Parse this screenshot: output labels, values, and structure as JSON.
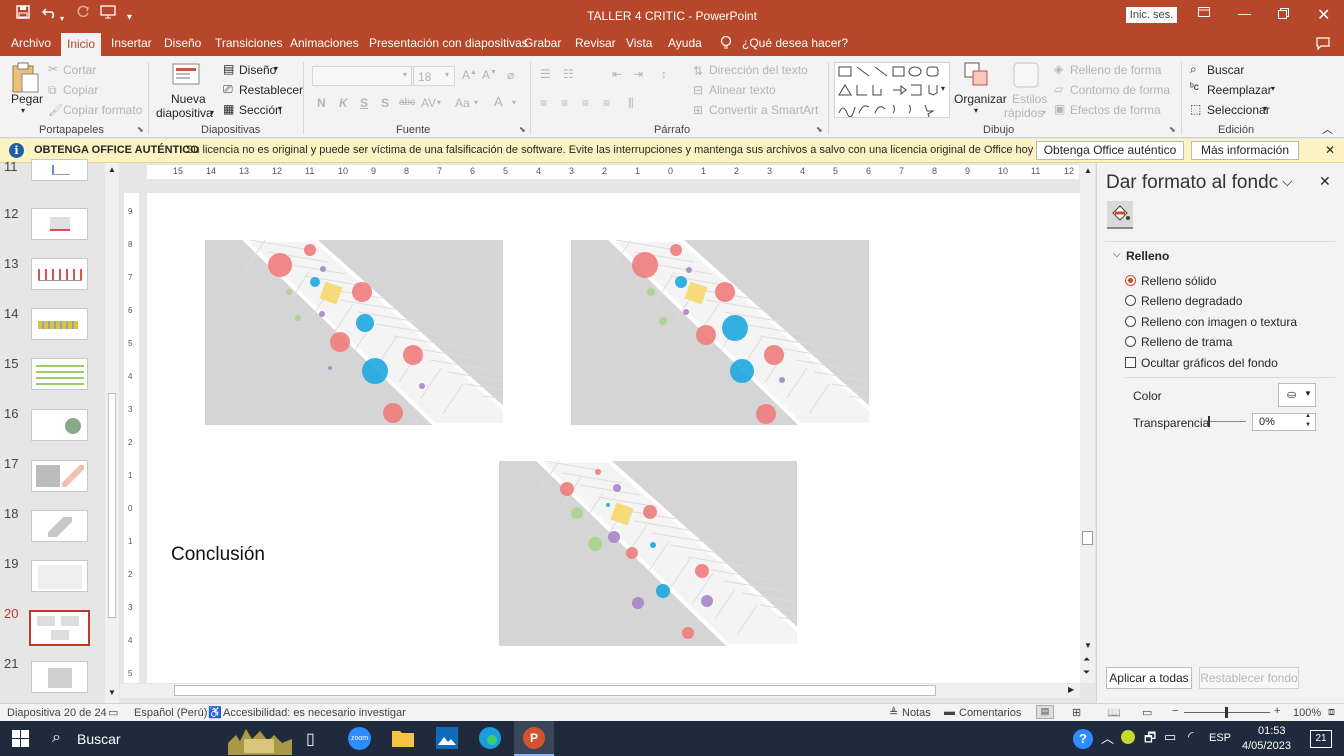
{
  "window": {
    "title": "TALLER 4 CRITIC  -  PowerPoint",
    "signin_label": "Inic. ses."
  },
  "tabs": [
    "Archivo",
    "Inicio",
    "Insertar",
    "Diseño",
    "Transiciones",
    "Animaciones",
    "Presentación con diapositivas",
    "Grabar",
    "Revisar",
    "Vista",
    "Ayuda"
  ],
  "tell_me": "¿Qué desea hacer?",
  "ribbon": {
    "clipboard": {
      "paste": "Pegar",
      "cut": "Cortar",
      "copy": "Copiar",
      "format_painter": "Copiar formato",
      "group": "Portapapeles"
    },
    "slides": {
      "new_slide_1": "Nueva",
      "new_slide_2": "diapositiva",
      "layout": "Diseño",
      "reset": "Restablecer",
      "section": "Sección",
      "group": "Diapositivas"
    },
    "font": {
      "size": "18",
      "group": "Fuente"
    },
    "paragraph": {
      "text_direction": "Dirección del texto",
      "align_text": "Alinear texto",
      "smartart": "Convertir a SmartArt",
      "group": "Párrafo"
    },
    "drawing": {
      "arrange": "Organizar",
      "quick_styles_1": "Estilos",
      "quick_styles_2": "rápidos",
      "shape_fill": "Relleno de forma",
      "shape_outline": "Contorno de forma",
      "shape_effects": "Efectos de forma",
      "group": "Dibujo"
    },
    "editing": {
      "find": "Buscar",
      "replace": "Reemplazar",
      "select": "Seleccionar",
      "group": "Edición"
    }
  },
  "infobar": {
    "title": "OBTENGA OFFICE AUTÉNTICO",
    "message": "Su licencia no es original y puede ser víctima de una falsificación de software. Evite las interrupciones y mantenga sus archivos a salvo con una licencia original de Office hoy mismo.",
    "btn_genuine": "Obtenga Office auténtico",
    "btn_more": "Más información"
  },
  "thumbnails": [
    "11",
    "12",
    "13",
    "14",
    "15",
    "16",
    "17",
    "18",
    "19",
    "20",
    "21"
  ],
  "ruler_h": [
    "15",
    "14",
    "13",
    "12",
    "11",
    "10",
    "9",
    "8",
    "7",
    "6",
    "5",
    "4",
    "3",
    "2",
    "1",
    "0",
    "1",
    "2",
    "3",
    "4",
    "5",
    "6",
    "7",
    "8",
    "9",
    "10",
    "11",
    "12"
  ],
  "ruler_v": [
    "9",
    "8",
    "7",
    "6",
    "5",
    "4",
    "3",
    "2",
    "1",
    "0",
    "1",
    "2",
    "3",
    "4",
    "5"
  ],
  "slide": {
    "conclusion": "Conclusión"
  },
  "pane": {
    "title": "Dar formato al fondc",
    "section": "Relleno",
    "opt_solid": "Relleno sólido",
    "opt_gradient": "Relleno degradado",
    "opt_picture": "Relleno con imagen o textura",
    "opt_pattern": "Relleno de trama",
    "hide_bg": "Ocultar gráficos del fondo",
    "color_label": "Color",
    "transparency_label": "Transparencia",
    "transparency_value": "0%",
    "apply_all": "Aplicar a todas",
    "reset_bg": "Restablecer fondo"
  },
  "status": {
    "slide_info": "Diapositiva 20 de 24",
    "language": "Español (Perú)",
    "accessibility": "Accesibilidad: es necesario investigar",
    "notes": "Notas",
    "comments": "Comentarios",
    "zoom": "100%"
  },
  "taskbar": {
    "search": "Buscar",
    "lang": "ESP",
    "time": "01:53",
    "date": "4/05/2023",
    "notif": "21"
  },
  "colors": {
    "accent": "#b7472a",
    "pink": "#f07c7c",
    "blue": "#1ea8e0",
    "yellow": "#f7d86b",
    "green": "#a8d48a",
    "purple": "#a585c9"
  }
}
